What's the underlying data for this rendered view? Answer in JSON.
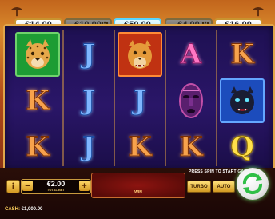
{
  "prizes": [
    {
      "value": "€14.00",
      "state": "lit"
    },
    {
      "value": "€10.00",
      "state": "dim"
    },
    {
      "value": "€50.00",
      "state": "active"
    },
    {
      "value": "€4.00",
      "state": "dim"
    },
    {
      "value": "€16.00",
      "state": "lit"
    }
  ],
  "reels": [
    [
      {
        "type": "tile",
        "icon": "cheetah"
      },
      {
        "type": "letter",
        "text": "K"
      },
      {
        "type": "letter",
        "text": "K"
      }
    ],
    [
      {
        "type": "letter",
        "text": "J"
      },
      {
        "type": "letter",
        "text": "J"
      },
      {
        "type": "letter",
        "text": "J"
      }
    ],
    [
      {
        "type": "tile",
        "icon": "lion"
      },
      {
        "type": "letter",
        "text": "J"
      },
      {
        "type": "letter",
        "text": "K"
      }
    ],
    [
      {
        "type": "letter",
        "text": "A"
      },
      {
        "type": "icon",
        "icon": "tribal-mask"
      },
      {
        "type": "letter",
        "text": "K"
      }
    ],
    [
      {
        "type": "letter",
        "text": "K"
      },
      {
        "type": "tile",
        "icon": "panther"
      },
      {
        "type": "letter",
        "text": "Q"
      }
    ]
  ],
  "controls": {
    "info_label": "i",
    "bet_minus": "−",
    "bet_plus": "+",
    "bet_value": "€2.00",
    "bet_label": "TOTAL BET",
    "win_label": "WIN",
    "hint": "PRESS SPIN TO START GAME",
    "turbo_label": "TURBO",
    "auto_label": "AUTO",
    "cash_label": "CASH:",
    "cash_value": "€1,000.00"
  },
  "colors": {
    "frame_bg": "#2a1668",
    "gold": "#e0a64a",
    "spin_glow": "#6ee06a"
  }
}
